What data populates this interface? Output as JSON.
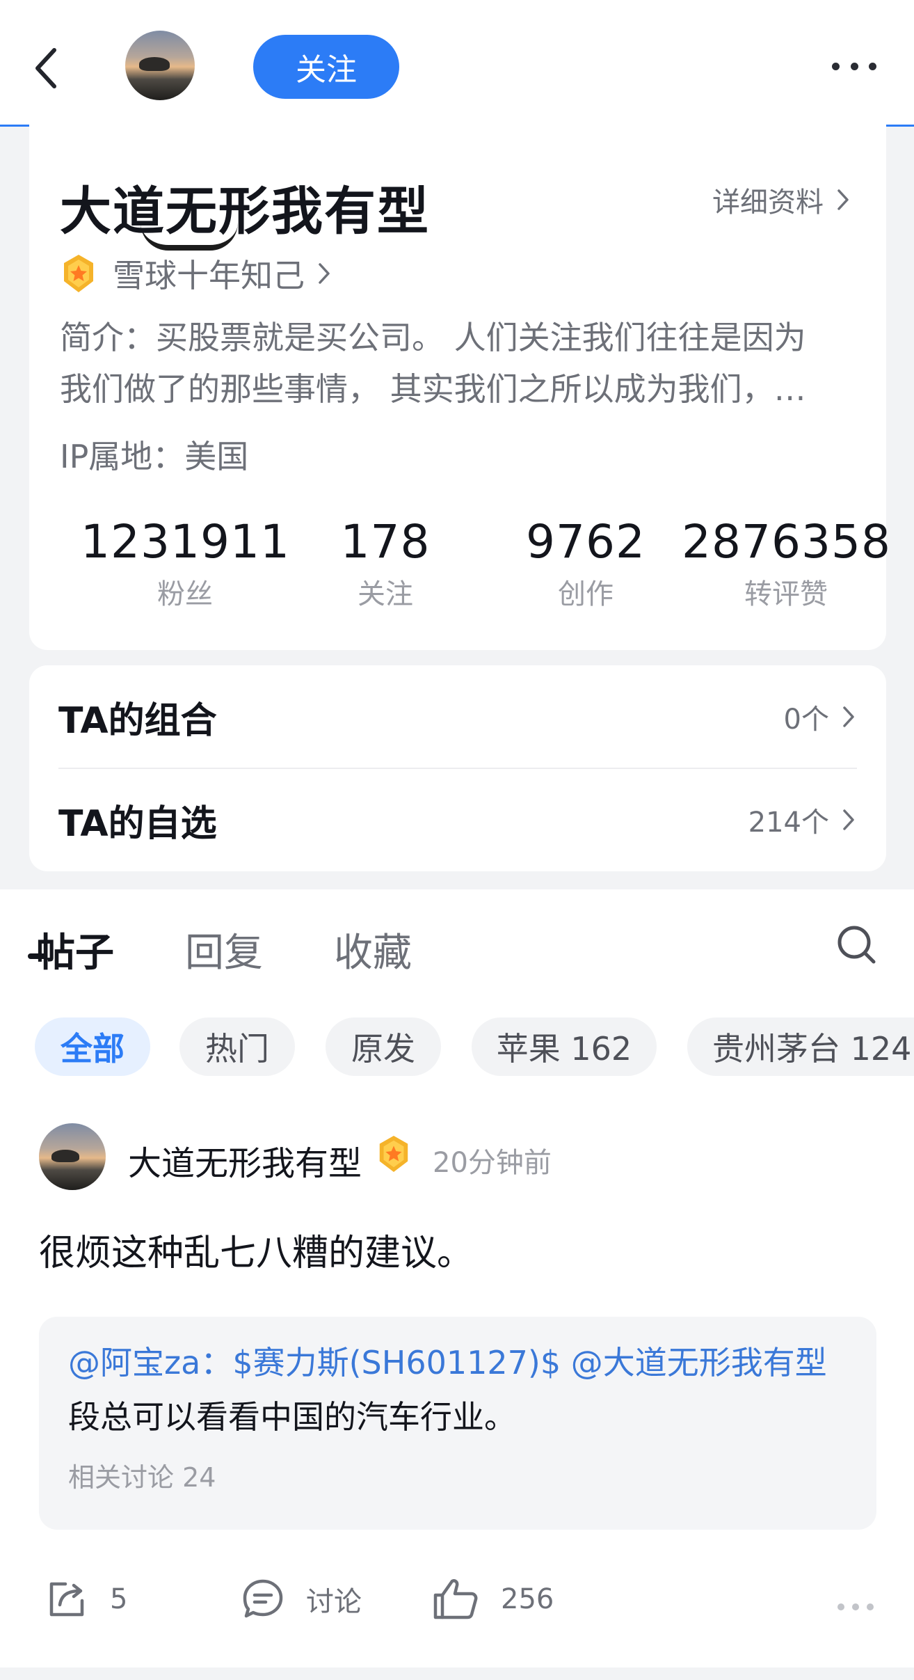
{
  "nav": {
    "follow_label": "关注",
    "accent_color": "#2c7cf6"
  },
  "profile": {
    "name": "大道无形我有型",
    "detail_link": "详细资料",
    "badge_text": "雪球十年知己",
    "intro_line1": "简介：买股票就是买公司。 人们关注我们往往是因为",
    "intro_line2": "我们做了的那些事情， 其实我们之所以成为我们，…",
    "ip": "IP属地：美国",
    "stats": [
      {
        "value": "1231911",
        "label": "粉丝"
      },
      {
        "value": "178",
        "label": "关注"
      },
      {
        "value": "9762",
        "label": "创作"
      },
      {
        "value": "2876358",
        "label": "转评赞"
      }
    ]
  },
  "ta": {
    "portfolio_title": "TA的组合",
    "portfolio_count": "0个",
    "watchlist_title": "TA的自选",
    "watchlist_count": "214个"
  },
  "tabs": [
    "帖子",
    "回复",
    "收藏"
  ],
  "chips": [
    "全部",
    "热门",
    "原发",
    "苹果 162",
    "贵州茅台 124"
  ],
  "post": {
    "author": "大道无形我有型",
    "time": "20分钟前",
    "body": "很烦这种乱七八糟的建议。",
    "quote_line1": "@阿宝za：$赛力斯(SH601127)$ @大道无形我有型",
    "quote_line2": "段总可以看看中国的汽车行业。",
    "quote_meta": "相关讨论 24",
    "share_count": "5",
    "comment_label": "讨论",
    "like_count": "256"
  }
}
